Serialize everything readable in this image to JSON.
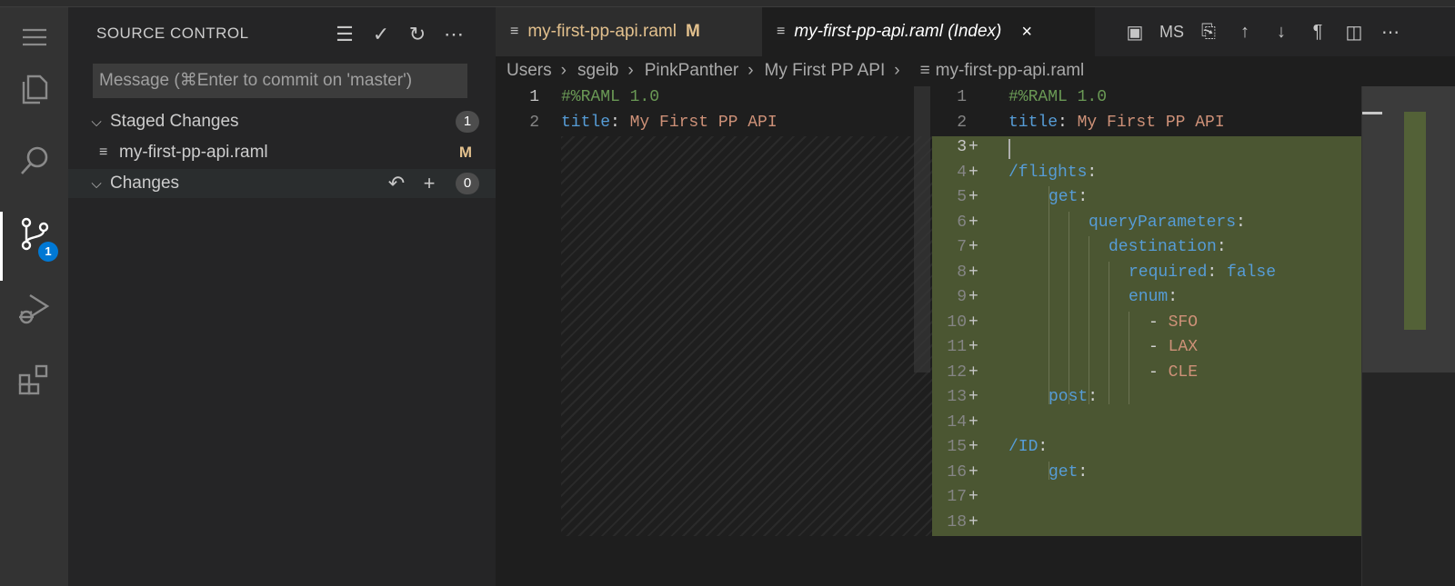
{
  "activity_bar": {
    "icons": [
      "menu-icon",
      "explorer-icon",
      "search-icon",
      "source-control-icon",
      "run-debug-icon",
      "extensions-icon"
    ],
    "scm_badge": "1"
  },
  "sidebar": {
    "title": "SOURCE CONTROL",
    "actions": [
      "view-as-tree-icon",
      "commit-icon",
      "refresh-icon",
      "more-actions-icon"
    ],
    "message_placeholder": "Message (⌘Enter to commit on 'master')",
    "staged": {
      "label": "Staged Changes",
      "count": "1",
      "files": [
        {
          "name": "my-first-pp-api.raml",
          "status": "M"
        }
      ]
    },
    "changes": {
      "label": "Changes",
      "count": "0"
    }
  },
  "tabs": [
    {
      "label": "my-first-pp-api.raml",
      "modified": "M"
    },
    {
      "label": "my-first-pp-api.raml (Index)",
      "close": "×"
    }
  ],
  "editor_actions": {
    "ms_label": "MS"
  },
  "breadcrumbs": [
    "Users",
    "sgeib",
    "PinkPanther",
    "My First PP API",
    "my-first-pp-api.raml"
  ],
  "left_editor": {
    "lines": [
      {
        "n": "1",
        "text": "#%RAML 1.0"
      },
      {
        "n": "2",
        "key": "title",
        "value": "My First PP API"
      }
    ]
  },
  "right_editor": {
    "line_numbers": [
      "1",
      "2",
      "3",
      "4",
      "5",
      "6",
      "7",
      "8",
      "9",
      "10",
      "11",
      "12",
      "13",
      "14",
      "15",
      "16",
      "17",
      "18"
    ],
    "line1": "#%RAML 1.0",
    "line2_key": "title",
    "line2_value": "My First PP API",
    "keys": {
      "flights": "/flights",
      "get": "get",
      "queryParameters": "queryParameters",
      "destination": "destination",
      "required": "required",
      "required_val": "false",
      "enum": "enum",
      "sfo": "SFO",
      "lax": "LAX",
      "cle": "CLE",
      "post": "post",
      "id": "/ID",
      "get2": "get"
    },
    "plus_mark": "+"
  }
}
